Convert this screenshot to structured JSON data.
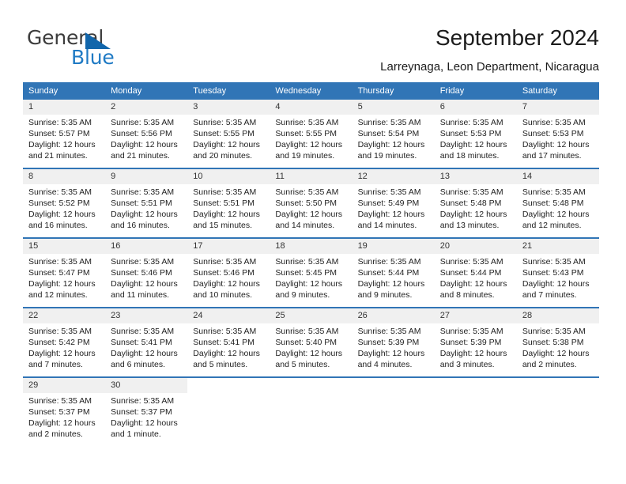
{
  "branding": {
    "name_top": "General",
    "name_bottom": "Blue",
    "triangle_color": "#1266ab",
    "blue_color": "#1f7ac4",
    "gray_color": "#3c3c3c"
  },
  "header": {
    "title": "September 2024",
    "subtitle": "Larreynaga, Leon Department, Nicaragua"
  },
  "theme": {
    "header_blue": "#3175b6",
    "daynum_band": "#f0f0f0",
    "row_separator": "#3175b6",
    "text": "#222222"
  },
  "weekdays": [
    "Sunday",
    "Monday",
    "Tuesday",
    "Wednesday",
    "Thursday",
    "Friday",
    "Saturday"
  ],
  "weeks": [
    [
      {
        "day": "1",
        "sunrise": "Sunrise: 5:35 AM",
        "sunset": "Sunset: 5:57 PM",
        "daylight1": "Daylight: 12 hours",
        "daylight2": "and 21 minutes."
      },
      {
        "day": "2",
        "sunrise": "Sunrise: 5:35 AM",
        "sunset": "Sunset: 5:56 PM",
        "daylight1": "Daylight: 12 hours",
        "daylight2": "and 21 minutes."
      },
      {
        "day": "3",
        "sunrise": "Sunrise: 5:35 AM",
        "sunset": "Sunset: 5:55 PM",
        "daylight1": "Daylight: 12 hours",
        "daylight2": "and 20 minutes."
      },
      {
        "day": "4",
        "sunrise": "Sunrise: 5:35 AM",
        "sunset": "Sunset: 5:55 PM",
        "daylight1": "Daylight: 12 hours",
        "daylight2": "and 19 minutes."
      },
      {
        "day": "5",
        "sunrise": "Sunrise: 5:35 AM",
        "sunset": "Sunset: 5:54 PM",
        "daylight1": "Daylight: 12 hours",
        "daylight2": "and 19 minutes."
      },
      {
        "day": "6",
        "sunrise": "Sunrise: 5:35 AM",
        "sunset": "Sunset: 5:53 PM",
        "daylight1": "Daylight: 12 hours",
        "daylight2": "and 18 minutes."
      },
      {
        "day": "7",
        "sunrise": "Sunrise: 5:35 AM",
        "sunset": "Sunset: 5:53 PM",
        "daylight1": "Daylight: 12 hours",
        "daylight2": "and 17 minutes."
      }
    ],
    [
      {
        "day": "8",
        "sunrise": "Sunrise: 5:35 AM",
        "sunset": "Sunset: 5:52 PM",
        "daylight1": "Daylight: 12 hours",
        "daylight2": "and 16 minutes."
      },
      {
        "day": "9",
        "sunrise": "Sunrise: 5:35 AM",
        "sunset": "Sunset: 5:51 PM",
        "daylight1": "Daylight: 12 hours",
        "daylight2": "and 16 minutes."
      },
      {
        "day": "10",
        "sunrise": "Sunrise: 5:35 AM",
        "sunset": "Sunset: 5:51 PM",
        "daylight1": "Daylight: 12 hours",
        "daylight2": "and 15 minutes."
      },
      {
        "day": "11",
        "sunrise": "Sunrise: 5:35 AM",
        "sunset": "Sunset: 5:50 PM",
        "daylight1": "Daylight: 12 hours",
        "daylight2": "and 14 minutes."
      },
      {
        "day": "12",
        "sunrise": "Sunrise: 5:35 AM",
        "sunset": "Sunset: 5:49 PM",
        "daylight1": "Daylight: 12 hours",
        "daylight2": "and 14 minutes."
      },
      {
        "day": "13",
        "sunrise": "Sunrise: 5:35 AM",
        "sunset": "Sunset: 5:48 PM",
        "daylight1": "Daylight: 12 hours",
        "daylight2": "and 13 minutes."
      },
      {
        "day": "14",
        "sunrise": "Sunrise: 5:35 AM",
        "sunset": "Sunset: 5:48 PM",
        "daylight1": "Daylight: 12 hours",
        "daylight2": "and 12 minutes."
      }
    ],
    [
      {
        "day": "15",
        "sunrise": "Sunrise: 5:35 AM",
        "sunset": "Sunset: 5:47 PM",
        "daylight1": "Daylight: 12 hours",
        "daylight2": "and 12 minutes."
      },
      {
        "day": "16",
        "sunrise": "Sunrise: 5:35 AM",
        "sunset": "Sunset: 5:46 PM",
        "daylight1": "Daylight: 12 hours",
        "daylight2": "and 11 minutes."
      },
      {
        "day": "17",
        "sunrise": "Sunrise: 5:35 AM",
        "sunset": "Sunset: 5:46 PM",
        "daylight1": "Daylight: 12 hours",
        "daylight2": "and 10 minutes."
      },
      {
        "day": "18",
        "sunrise": "Sunrise: 5:35 AM",
        "sunset": "Sunset: 5:45 PM",
        "daylight1": "Daylight: 12 hours",
        "daylight2": "and 9 minutes."
      },
      {
        "day": "19",
        "sunrise": "Sunrise: 5:35 AM",
        "sunset": "Sunset: 5:44 PM",
        "daylight1": "Daylight: 12 hours",
        "daylight2": "and 9 minutes."
      },
      {
        "day": "20",
        "sunrise": "Sunrise: 5:35 AM",
        "sunset": "Sunset: 5:44 PM",
        "daylight1": "Daylight: 12 hours",
        "daylight2": "and 8 minutes."
      },
      {
        "day": "21",
        "sunrise": "Sunrise: 5:35 AM",
        "sunset": "Sunset: 5:43 PM",
        "daylight1": "Daylight: 12 hours",
        "daylight2": "and 7 minutes."
      }
    ],
    [
      {
        "day": "22",
        "sunrise": "Sunrise: 5:35 AM",
        "sunset": "Sunset: 5:42 PM",
        "daylight1": "Daylight: 12 hours",
        "daylight2": "and 7 minutes."
      },
      {
        "day": "23",
        "sunrise": "Sunrise: 5:35 AM",
        "sunset": "Sunset: 5:41 PM",
        "daylight1": "Daylight: 12 hours",
        "daylight2": "and 6 minutes."
      },
      {
        "day": "24",
        "sunrise": "Sunrise: 5:35 AM",
        "sunset": "Sunset: 5:41 PM",
        "daylight1": "Daylight: 12 hours",
        "daylight2": "and 5 minutes."
      },
      {
        "day": "25",
        "sunrise": "Sunrise: 5:35 AM",
        "sunset": "Sunset: 5:40 PM",
        "daylight1": "Daylight: 12 hours",
        "daylight2": "and 5 minutes."
      },
      {
        "day": "26",
        "sunrise": "Sunrise: 5:35 AM",
        "sunset": "Sunset: 5:39 PM",
        "daylight1": "Daylight: 12 hours",
        "daylight2": "and 4 minutes."
      },
      {
        "day": "27",
        "sunrise": "Sunrise: 5:35 AM",
        "sunset": "Sunset: 5:39 PM",
        "daylight1": "Daylight: 12 hours",
        "daylight2": "and 3 minutes."
      },
      {
        "day": "28",
        "sunrise": "Sunrise: 5:35 AM",
        "sunset": "Sunset: 5:38 PM",
        "daylight1": "Daylight: 12 hours",
        "daylight2": "and 2 minutes."
      }
    ],
    [
      {
        "day": "29",
        "sunrise": "Sunrise: 5:35 AM",
        "sunset": "Sunset: 5:37 PM",
        "daylight1": "Daylight: 12 hours",
        "daylight2": "and 2 minutes."
      },
      {
        "day": "30",
        "sunrise": "Sunrise: 5:35 AM",
        "sunset": "Sunset: 5:37 PM",
        "daylight1": "Daylight: 12 hours",
        "daylight2": "and 1 minute."
      },
      {
        "day": "",
        "sunrise": "",
        "sunset": "",
        "daylight1": "",
        "daylight2": ""
      },
      {
        "day": "",
        "sunrise": "",
        "sunset": "",
        "daylight1": "",
        "daylight2": ""
      },
      {
        "day": "",
        "sunrise": "",
        "sunset": "",
        "daylight1": "",
        "daylight2": ""
      },
      {
        "day": "",
        "sunrise": "",
        "sunset": "",
        "daylight1": "",
        "daylight2": ""
      },
      {
        "day": "",
        "sunrise": "",
        "sunset": "",
        "daylight1": "",
        "daylight2": ""
      }
    ]
  ]
}
